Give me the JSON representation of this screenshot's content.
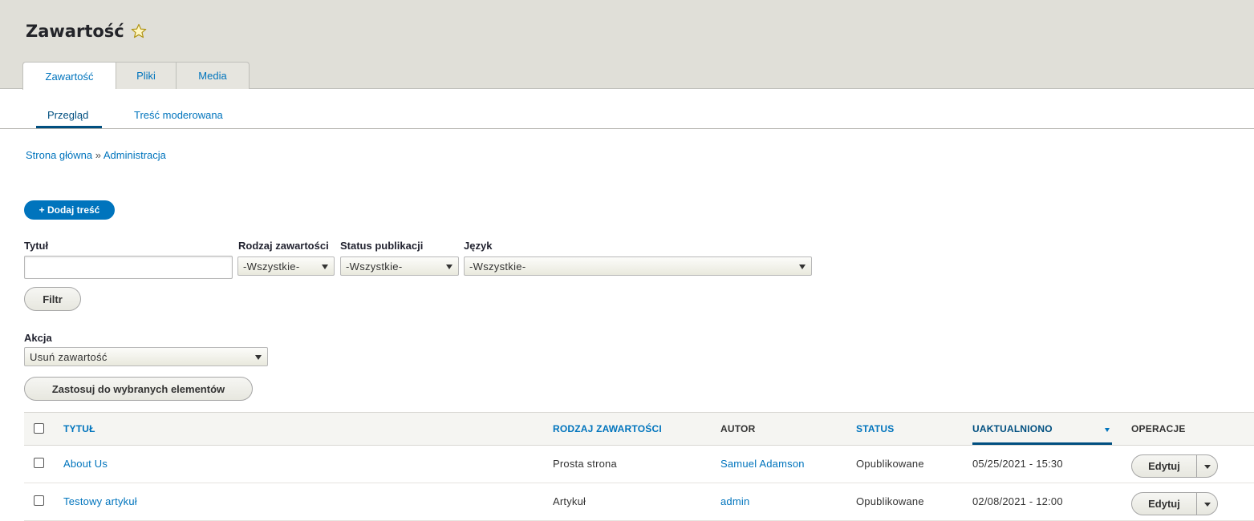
{
  "header": {
    "title": "Zawartość",
    "star_icon": "star-outline-icon",
    "tabs": [
      {
        "label": "Zawartość",
        "active": true
      },
      {
        "label": "Pliki",
        "active": false
      },
      {
        "label": "Media",
        "active": false
      }
    ]
  },
  "subtabs": [
    {
      "label": "Przegląd",
      "active": true
    },
    {
      "label": "Treść moderowana",
      "active": false
    }
  ],
  "breadcrumb": {
    "items": [
      "Strona główna",
      "Administracja"
    ],
    "separator": "»"
  },
  "add_button": {
    "label": "+ Dodaj treść"
  },
  "filters": {
    "title": {
      "label": "Tytuł",
      "value": ""
    },
    "content_type": {
      "label": "Rodzaj zawartości",
      "value": "-Wszystkie-"
    },
    "status": {
      "label": "Status publikacji",
      "value": "-Wszystkie-"
    },
    "language": {
      "label": "Język",
      "value": "-Wszystkie-"
    },
    "filter_button": "Filtr"
  },
  "bulk": {
    "label": "Akcja",
    "value": "Usuń zawartość",
    "apply_button": "Zastosuj do wybranych elementów"
  },
  "table": {
    "columns": {
      "title": "TYTUŁ",
      "type": "RODZAJ ZAWARTOŚCI",
      "author": "AUTOR",
      "status": "STATUS",
      "updated": "UAKTUALNIONO",
      "operations": "OPERACJE"
    },
    "rows": [
      {
        "title": "About Us",
        "type": "Prosta strona",
        "author": "Samuel Adamson",
        "status": "Opublikowane",
        "updated": "05/25/2021 - 15:30",
        "edit": "Edytuj"
      },
      {
        "title": "Testowy artykuł",
        "type": "Artykuł",
        "author": "admin",
        "status": "Opublikowane",
        "updated": "02/08/2021 - 12:00",
        "edit": "Edytuj"
      }
    ]
  },
  "colors": {
    "accent": "#0074bd",
    "header_bg": "#e0dfd8",
    "active_dark": "#004f80"
  }
}
